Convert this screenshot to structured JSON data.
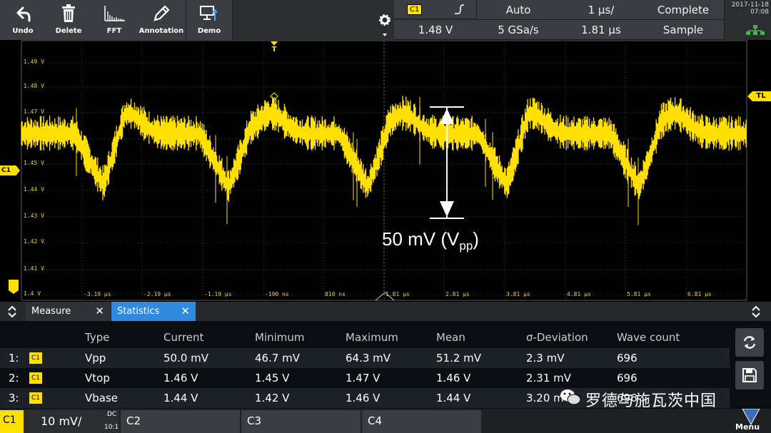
{
  "toolbar": {
    "buttons": [
      {
        "label": "Undo",
        "icon": "undo-icon"
      },
      {
        "label": "Delete",
        "icon": "trash-icon"
      },
      {
        "label": "FFT",
        "icon": "spectrum-icon"
      },
      {
        "label": "Annotation",
        "icon": "pencil-icon"
      },
      {
        "label": "Demo",
        "icon": "demo-icon"
      }
    ]
  },
  "header": {
    "channel": "C1",
    "trigger_level": "1.48 V",
    "trigger_mode": "Auto",
    "sample_rate": "5 GSa/s",
    "time_scale": "1 µs/",
    "trigger_position": "1.81 µs",
    "acq_status": "Complete",
    "acq_mode": "Sample",
    "date": "2017-11-18",
    "time": "07:08"
  },
  "plot": {
    "trigger_marker": "T",
    "trigger_level_marker": "TL",
    "channel_marker": "C1",
    "y_ticks": [
      "1.49 V",
      "1.48 V",
      "1.47 V",
      "1.46 V",
      "1.45 V",
      "1.44 V",
      "1.43 V",
      "1.42 V",
      "1.41 V",
      "1.4 V"
    ],
    "x_ticks": [
      "-3.19 µs",
      "-2.19 µs",
      "-1.19 µs",
      "-190 ns",
      "810 ns",
      "1.81 µs",
      "2.81 µs",
      "3.81 µs",
      "4.81 µs",
      "5.81 µs",
      "6.81 µs"
    ],
    "annotation_value": "50 mV (V",
    "annotation_sub": "pp",
    "annotation_close": ")",
    "trace_color": "#ffe000"
  },
  "tabs": {
    "measure": "Measure",
    "statistics": "Statistics",
    "close": "✕"
  },
  "stats": {
    "columns": [
      "Type",
      "Current",
      "Minimum",
      "Maximum",
      "Mean",
      "σ-Deviation",
      "Wave count"
    ],
    "rows": [
      {
        "idx": "1:",
        "ch": "C1",
        "type": "Vpp",
        "current": "50.0 mV",
        "min": "46.7 mV",
        "max": "64.3 mV",
        "mean": "51.2 mV",
        "sd": "2.3 mV",
        "count": "696"
      },
      {
        "idx": "2:",
        "ch": "C1",
        "type": "Vtop",
        "current": "1.46 V",
        "min": "1.45 V",
        "max": "1.47 V",
        "mean": "1.46 V",
        "sd": "2.31 mV",
        "count": "696"
      },
      {
        "idx": "3:",
        "ch": "C1",
        "type": "Vbase",
        "current": "1.44 V",
        "min": "1.42 V",
        "max": "1.46 V",
        "mean": "1.44 V",
        "sd": "3.20 mV",
        "count": "696"
      }
    ]
  },
  "channels": {
    "c1_label": "C1",
    "c1_scale": "10 mV/",
    "c1_coupling": "DC",
    "c1_probe": "10:1",
    "c2_label": "C2",
    "c3_label": "C3",
    "c4_label": "C4",
    "menu": "Menu"
  },
  "watermark": "罗德与施瓦茨中国"
}
